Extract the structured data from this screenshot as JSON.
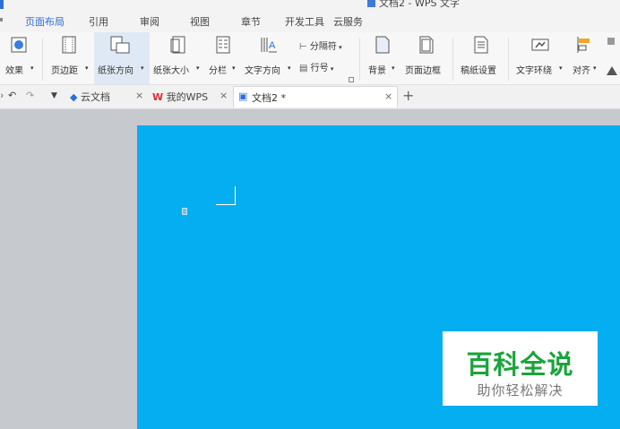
{
  "window": {
    "title_fragment": "文档2 - WPS 文字"
  },
  "menu": {
    "tabs": [
      {
        "label": "页面布局",
        "active": true
      },
      {
        "label": "引用"
      },
      {
        "label": "审阅"
      },
      {
        "label": "视图"
      },
      {
        "label": "章节"
      },
      {
        "label": "开发工具"
      },
      {
        "label": "云服务"
      }
    ]
  },
  "ribbon": {
    "effects": "效果",
    "margins": "页边距",
    "orientation": "纸张方向",
    "size": "纸张大小",
    "columns": "分栏",
    "text_direction": "文字方向",
    "breaks": "分隔符",
    "line_numbers": "行号",
    "background": "背景",
    "page_border": "页面边框",
    "draft_paper": "稿纸设置",
    "text_wrap": "文字环绕",
    "align": "对齐"
  },
  "tabbar": {
    "cloud_docs": "云文档",
    "my_wps": "我的WPS",
    "current_doc": "文档2 *",
    "close_glyph": "×",
    "new_tab_glyph": "+"
  },
  "watermark": {
    "title": "百科全说",
    "subtitle": "助你轻松解决"
  },
  "colors": {
    "accent": "#2a6fd6",
    "page_background": "#05aef0",
    "workspace": "#c6c9ce",
    "watermark_green": "#1aa43c"
  }
}
